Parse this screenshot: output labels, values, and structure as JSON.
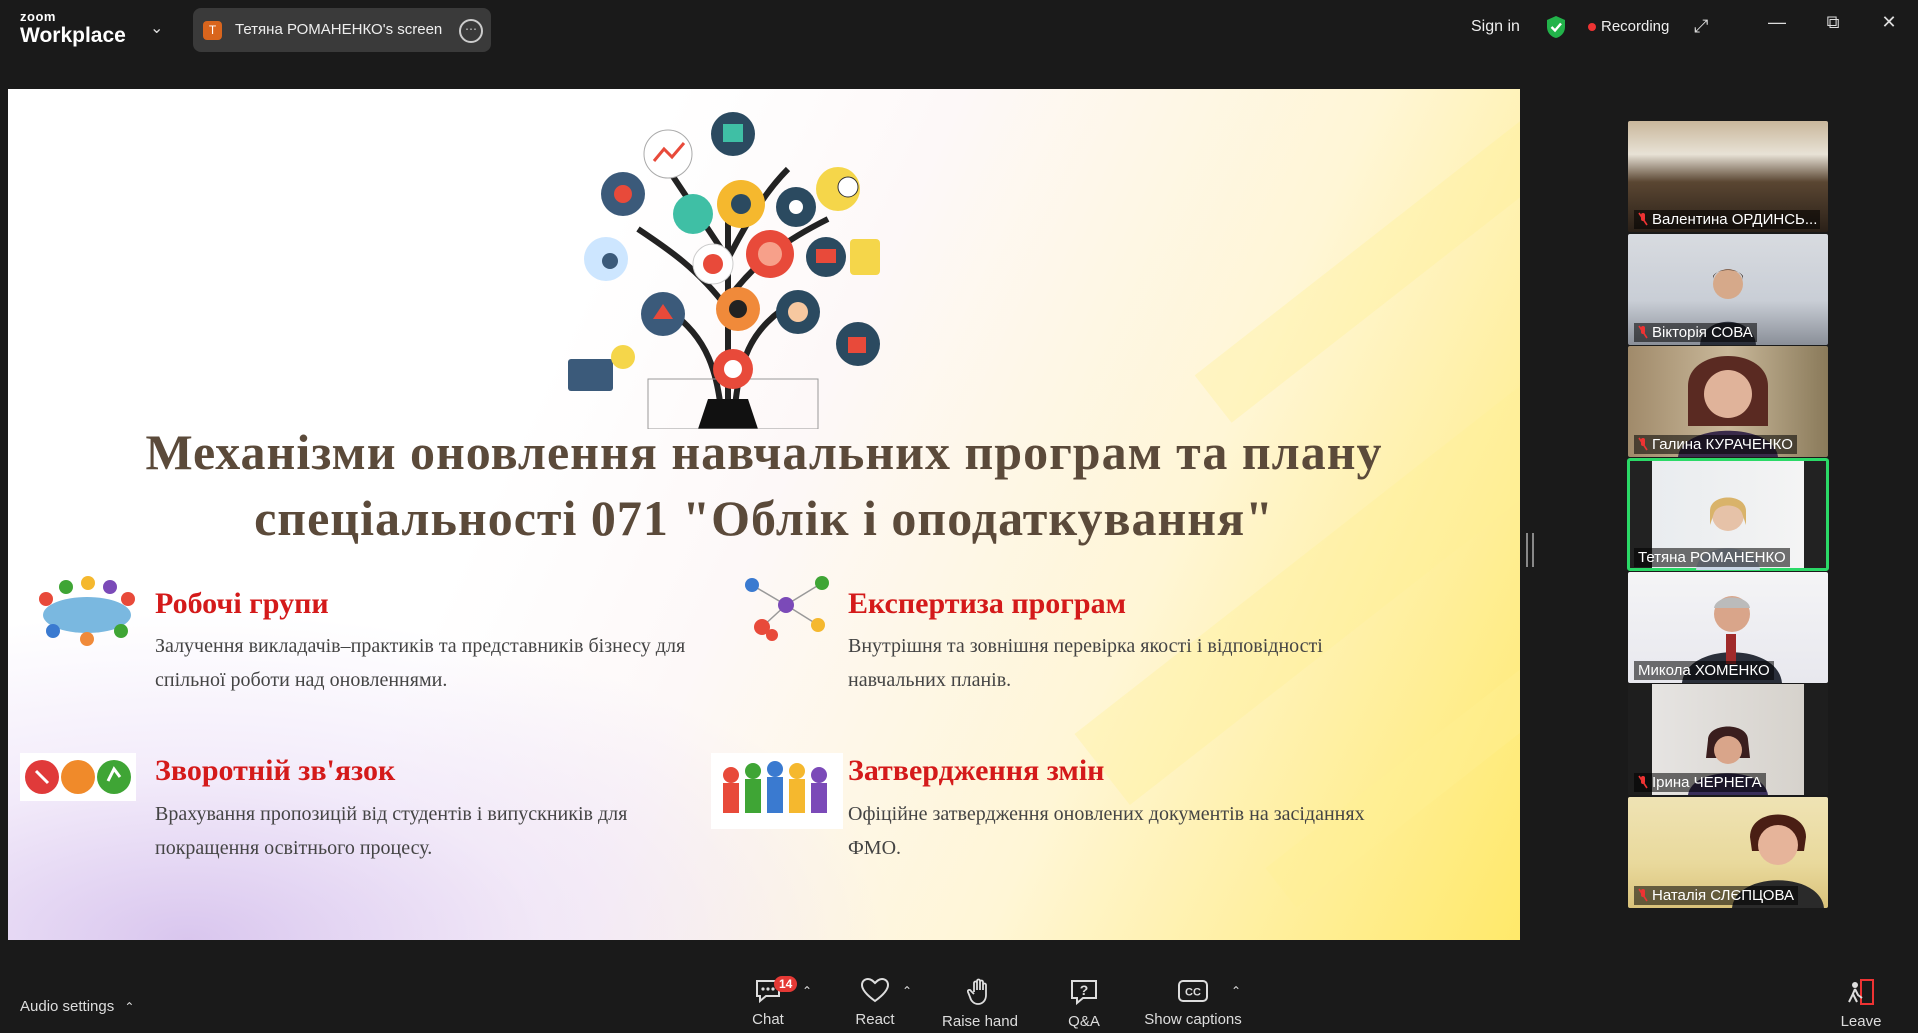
{
  "app": {
    "brand_top": "zoom",
    "brand_bottom": "Workplace",
    "share_tab": {
      "avatar": "T",
      "label": "Тетяна РОМАНЕНКО's screen"
    },
    "sign_in": "Sign in",
    "recording": "Recording",
    "colors": {
      "bg": "#1a1a1a",
      "accent_green": "#2bd967",
      "record_red": "#e33333",
      "badge_red": "#e53935"
    }
  },
  "slide": {
    "title_line1": "Механізми оновлення навчальних програм та плану",
    "title_line2": "спеціальності 071 \"Облік і оподаткування\"",
    "sections": [
      {
        "title": "Робочі групи",
        "desc_line1": "Залучення викладачів–практиків та представників бізнесу для",
        "desc_line2": "спільної роботи над оновленнями."
      },
      {
        "title": "Експертиза програм",
        "desc_line1": "Внутрішня та зовнішня перевірка якості і відповідності",
        "desc_line2": "навчальних планів."
      },
      {
        "title": "Зворотній зв'язок",
        "desc_line1": "Врахування пропозицій від студентів і випускників для",
        "desc_line2": "покращення освітнього процесу."
      },
      {
        "title": "Затвердження змін",
        "desc_line1": "Офіційне затвердження оновлених документів на засіданнях",
        "desc_line2": "ФМО."
      }
    ],
    "colors": {
      "title": "#5b4a3a",
      "section_title": "#d41a1a",
      "text": "#444444"
    }
  },
  "participants": [
    {
      "name": "Валентина ОРДИНСЬ..."
    },
    {
      "name": "Вікторія СОВА"
    },
    {
      "name": "Галина КУРАЧЕНКО"
    },
    {
      "name": "Тетяна РОМАНЕНКО"
    },
    {
      "name": "Микола ХОМЕНКО"
    },
    {
      "name": "Ірина ЧЕРНЕГА"
    },
    {
      "name": "Наталія СЛЄПЦОВА"
    }
  ],
  "toolbar": {
    "audio_settings": "Audio settings",
    "chat": "Chat",
    "chat_badge": "14",
    "react": "React",
    "raise_hand": "Raise hand",
    "qa": "Q&A",
    "show_captions": "Show captions",
    "leave": "Leave"
  }
}
